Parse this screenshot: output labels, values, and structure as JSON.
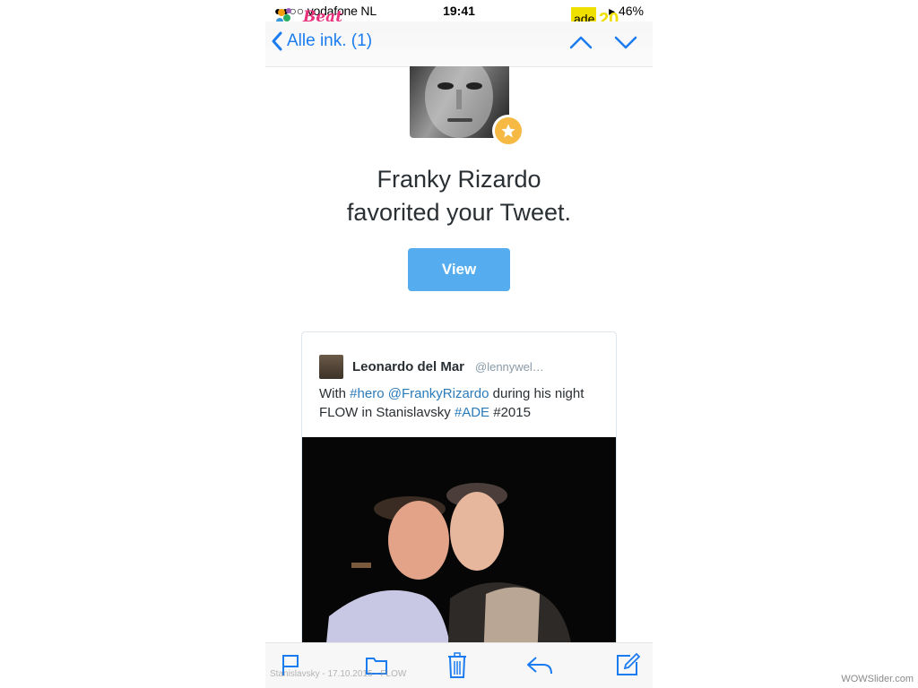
{
  "status": {
    "carrier": "●●○○ vodafone NL",
    "time": "19:41",
    "battery": "▸ 46%"
  },
  "logos": {
    "left_text": "Beat",
    "right_text": "ade"
  },
  "nav": {
    "back_label": "Alle ink. (1)"
  },
  "notification": {
    "line1": "Franky Rizardo",
    "line2": "favorited your Tweet.",
    "view_label": "View"
  },
  "tweet": {
    "author_name": "Leonardo del Mar",
    "author_handle": "@lennywel…",
    "text_prefix": "With ",
    "hashtag1": "#hero",
    "space1": " ",
    "mention": "@FrankyRizardo",
    "text_mid": " during his night FLOW in Stanislavsky ",
    "hashtag2": "#ADE",
    "text_suffix": " #2015"
  },
  "watermark": "Stanislavsky - 17.10.2015 - FLOW",
  "slider_credit": "WOWSlider.com",
  "colors": {
    "ios_blue": "#1a7cf0",
    "twitter_blue": "#55acee",
    "star": "#f5b944",
    "link": "#2b7bb9"
  }
}
